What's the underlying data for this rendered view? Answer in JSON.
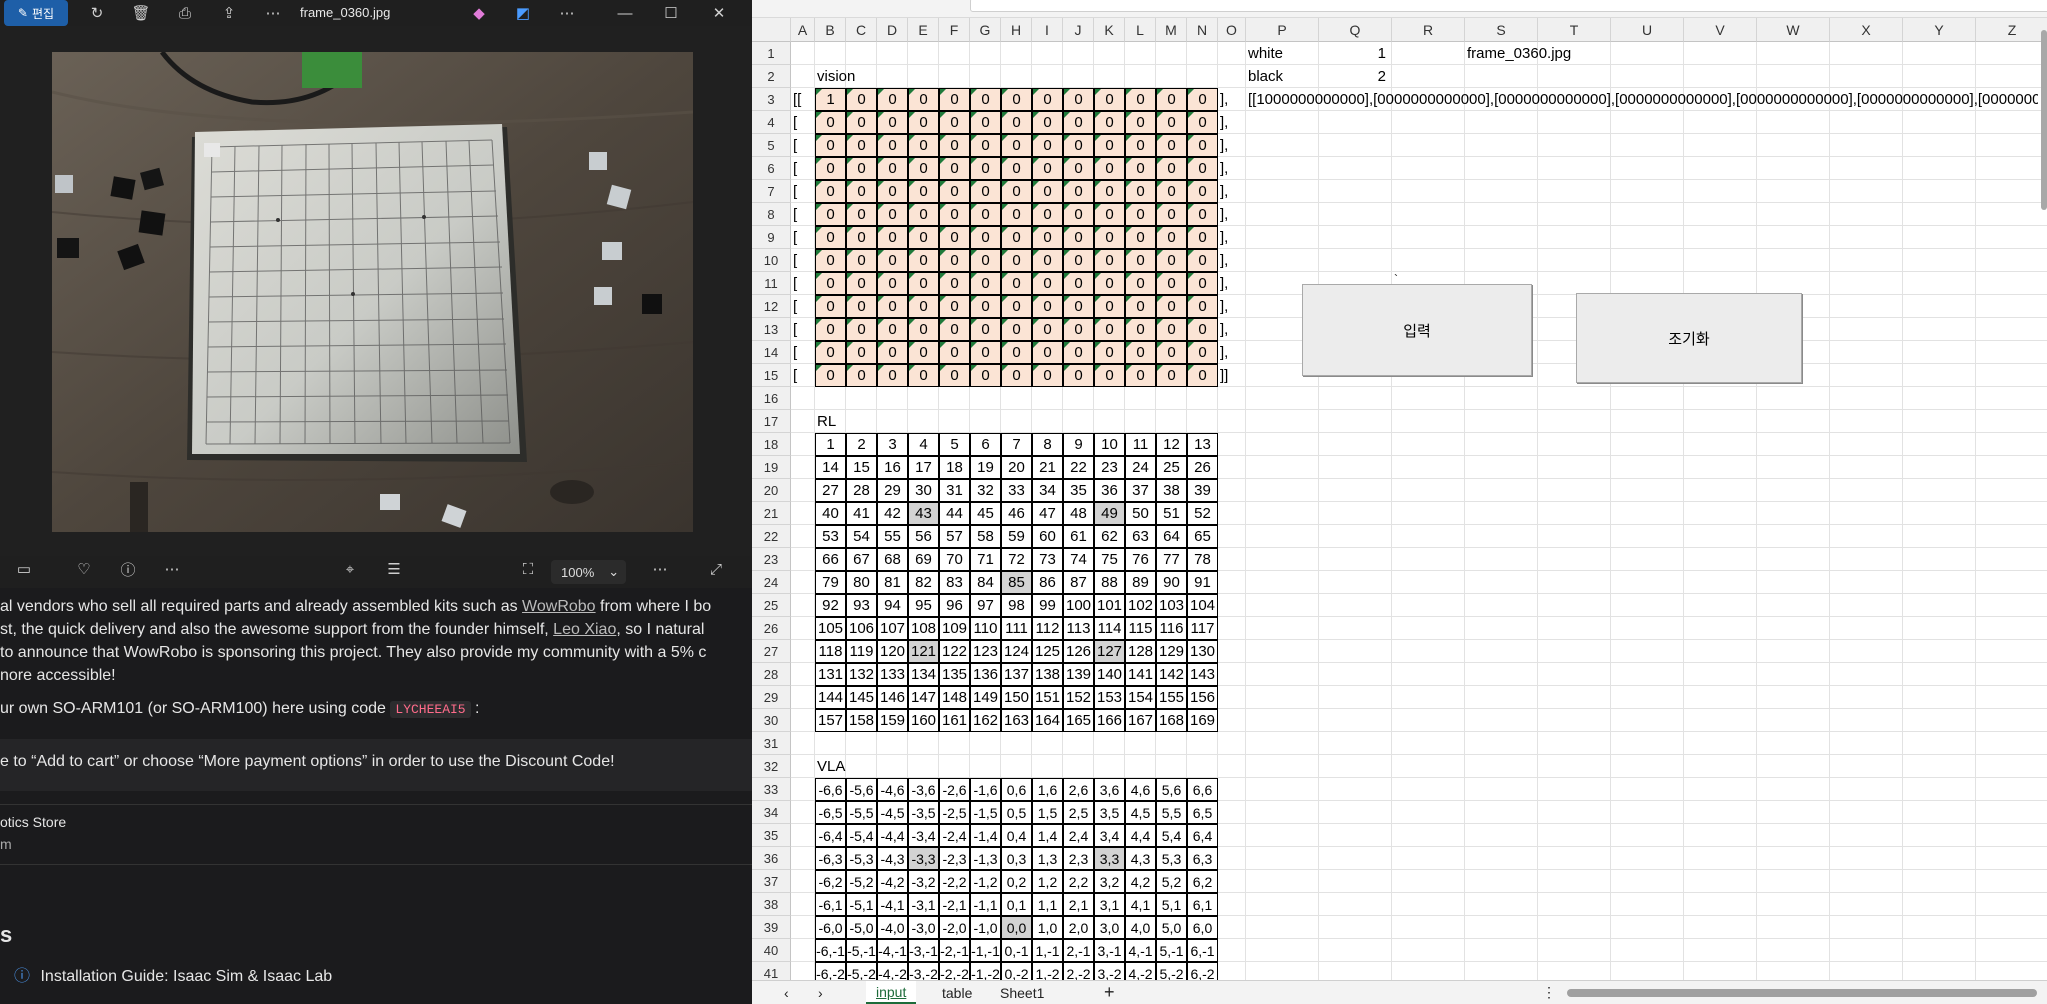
{
  "viewer": {
    "edit_label": "편집",
    "file_title": "frame_0360.jpg",
    "zoom": "100%",
    "photo_alt": "Go board with black and white stones on wooden floor"
  },
  "webpage": {
    "line1a": "al vendors who sell all required parts and already assembled kits such as ",
    "line1_link": "WowRobo",
    "line1b": " from where I bo",
    "line2a": "st, the quick delivery and also the awesome support from the founder himself, ",
    "line2_link": "Leo Xiao",
    "line2b": ", so I natural",
    "line3": " to announce that WowRobo is sponsoring this project. They also provide my community with a 5% c",
    "line4": "nore accessible!",
    "line5a": "ur own SO-ARM101 (or SO-ARM100) here using code ",
    "line5_code": "LYCHEEAI5",
    "line5b": " :",
    "note": "e to “Add to cart” or choose “More payment options” in order to use the Discount Code!",
    "store1": "otics Store",
    "store2": "m",
    "section": "s",
    "guide": "Installation Guide: Isaac Sim & Isaac Lab"
  },
  "sheet": {
    "columns": [
      "A",
      "B",
      "C",
      "D",
      "E",
      "F",
      "G",
      "H",
      "I",
      "J",
      "K",
      "L",
      "M",
      "N",
      "O",
      "P",
      "Q",
      "R",
      "S",
      "T",
      "U",
      "V",
      "W",
      "X",
      "Y",
      "Z"
    ],
    "labels": {
      "vision": "vision",
      "rl": "RL",
      "vla": "VLA",
      "white": "white",
      "white_val": "1",
      "black": "black",
      "black_val": "2",
      "filename": "frame_0360.jpg",
      "matrix_string": "[[1000000000000],[0000000000000],[0000000000000],[0000000000000],[0000000000000],[0000000000000],[0000000000",
      "open_first": "[[",
      "open": "[",
      "close": "],",
      "close_last": "]]",
      "tick": "`"
    },
    "buttons": {
      "input": "입력",
      "reset": "조기화"
    },
    "vision_rows": [
      [
        "1",
        "0",
        "0",
        "0",
        "0",
        "0",
        "0",
        "0",
        "0",
        "0",
        "0",
        "0",
        "0"
      ],
      [
        "0",
        "0",
        "0",
        "0",
        "0",
        "0",
        "0",
        "0",
        "0",
        "0",
        "0",
        "0",
        "0"
      ],
      [
        "0",
        "0",
        "0",
        "0",
        "0",
        "0",
        "0",
        "0",
        "0",
        "0",
        "0",
        "0",
        "0"
      ],
      [
        "0",
        "0",
        "0",
        "0",
        "0",
        "0",
        "0",
        "0",
        "0",
        "0",
        "0",
        "0",
        "0"
      ],
      [
        "0",
        "0",
        "0",
        "0",
        "0",
        "0",
        "0",
        "0",
        "0",
        "0",
        "0",
        "0",
        "0"
      ],
      [
        "0",
        "0",
        "0",
        "0",
        "0",
        "0",
        "0",
        "0",
        "0",
        "0",
        "0",
        "0",
        "0"
      ],
      [
        "0",
        "0",
        "0",
        "0",
        "0",
        "0",
        "0",
        "0",
        "0",
        "0",
        "0",
        "0",
        "0"
      ],
      [
        "0",
        "0",
        "0",
        "0",
        "0",
        "0",
        "0",
        "0",
        "0",
        "0",
        "0",
        "0",
        "0"
      ],
      [
        "0",
        "0",
        "0",
        "0",
        "0",
        "0",
        "0",
        "0",
        "0",
        "0",
        "0",
        "0",
        "0"
      ],
      [
        "0",
        "0",
        "0",
        "0",
        "0",
        "0",
        "0",
        "0",
        "0",
        "0",
        "0",
        "0",
        "0"
      ],
      [
        "0",
        "0",
        "0",
        "0",
        "0",
        "0",
        "0",
        "0",
        "0",
        "0",
        "0",
        "0",
        "0"
      ],
      [
        "0",
        "0",
        "0",
        "0",
        "0",
        "0",
        "0",
        "0",
        "0",
        "0",
        "0",
        "0",
        "0"
      ],
      [
        "0",
        "0",
        "0",
        "0",
        "0",
        "0",
        "0",
        "0",
        "0",
        "0",
        "0",
        "0",
        "0"
      ]
    ],
    "rl_rows": [
      [
        "1",
        "2",
        "3",
        "4",
        "5",
        "6",
        "7",
        "8",
        "9",
        "10",
        "11",
        "12",
        "13"
      ],
      [
        "14",
        "15",
        "16",
        "17",
        "18",
        "19",
        "20",
        "21",
        "22",
        "23",
        "24",
        "25",
        "26"
      ],
      [
        "27",
        "28",
        "29",
        "30",
        "31",
        "32",
        "33",
        "34",
        "35",
        "36",
        "37",
        "38",
        "39"
      ],
      [
        "40",
        "41",
        "42",
        "43",
        "44",
        "45",
        "46",
        "47",
        "48",
        "49",
        "50",
        "51",
        "52"
      ],
      [
        "53",
        "54",
        "55",
        "56",
        "57",
        "58",
        "59",
        "60",
        "61",
        "62",
        "63",
        "64",
        "65"
      ],
      [
        "66",
        "67",
        "68",
        "69",
        "70",
        "71",
        "72",
        "73",
        "74",
        "75",
        "76",
        "77",
        "78"
      ],
      [
        "79",
        "80",
        "81",
        "82",
        "83",
        "84",
        "85",
        "86",
        "87",
        "88",
        "89",
        "90",
        "91"
      ],
      [
        "92",
        "93",
        "94",
        "95",
        "96",
        "97",
        "98",
        "99",
        "100",
        "101",
        "102",
        "103",
        "104"
      ],
      [
        "105",
        "106",
        "107",
        "108",
        "109",
        "110",
        "111",
        "112",
        "113",
        "114",
        "115",
        "116",
        "117"
      ],
      [
        "118",
        "119",
        "120",
        "121",
        "122",
        "123",
        "124",
        "125",
        "126",
        "127",
        "128",
        "129",
        "130"
      ],
      [
        "131",
        "132",
        "133",
        "134",
        "135",
        "136",
        "137",
        "138",
        "139",
        "140",
        "141",
        "142",
        "143"
      ],
      [
        "144",
        "145",
        "146",
        "147",
        "148",
        "149",
        "150",
        "151",
        "152",
        "153",
        "154",
        "155",
        "156"
      ],
      [
        "157",
        "158",
        "159",
        "160",
        "161",
        "162",
        "163",
        "164",
        "165",
        "166",
        "167",
        "168",
        "169"
      ]
    ],
    "rl_highlight": [
      [
        3,
        3
      ],
      [
        3,
        9
      ],
      [
        6,
        6
      ],
      [
        9,
        3
      ],
      [
        9,
        9
      ]
    ],
    "vla_rows": [
      [
        "-6,6",
        "-5,6",
        "-4,6",
        "-3,6",
        "-2,6",
        "-1,6",
        "0,6",
        "1,6",
        "2,6",
        "3,6",
        "4,6",
        "5,6",
        "6,6"
      ],
      [
        "-6,5",
        "-5,5",
        "-4,5",
        "-3,5",
        "-2,5",
        "-1,5",
        "0,5",
        "1,5",
        "2,5",
        "3,5",
        "4,5",
        "5,5",
        "6,5"
      ],
      [
        "-6,4",
        "-5,4",
        "-4,4",
        "-3,4",
        "-2,4",
        "-1,4",
        "0,4",
        "1,4",
        "2,4",
        "3,4",
        "4,4",
        "5,4",
        "6,4"
      ],
      [
        "-6,3",
        "-5,3",
        "-4,3",
        "-3,3",
        "-2,3",
        "-1,3",
        "0,3",
        "1,3",
        "2,3",
        "3,3",
        "4,3",
        "5,3",
        "6,3"
      ],
      [
        "-6,2",
        "-5,2",
        "-4,2",
        "-3,2",
        "-2,2",
        "-1,2",
        "0,2",
        "1,2",
        "2,2",
        "3,2",
        "4,2",
        "5,2",
        "6,2"
      ],
      [
        "-6,1",
        "-5,1",
        "-4,1",
        "-3,1",
        "-2,1",
        "-1,1",
        "0,1",
        "1,1",
        "2,1",
        "3,1",
        "4,1",
        "5,1",
        "6,1"
      ],
      [
        "-6,0",
        "-5,0",
        "-4,0",
        "-3,0",
        "-2,0",
        "-1,0",
        "0,0",
        "1,0",
        "2,0",
        "3,0",
        "4,0",
        "5,0",
        "6,0"
      ],
      [
        "-6,-1",
        "-5,-1",
        "-4,-1",
        "-3,-1",
        "-2,-1",
        "-1,-1",
        "0,-1",
        "1,-1",
        "2,-1",
        "3,-1",
        "4,-1",
        "5,-1",
        "6,-1"
      ],
      [
        "-6,-2",
        "-5,-2",
        "-4,-2",
        "-3,-2",
        "-2,-2",
        "-1,-2",
        "0,-2",
        "1,-2",
        "2,-2",
        "3,-2",
        "4,-2",
        "5,-2",
        "6,-2"
      ]
    ],
    "vla_highlight": [
      [
        3,
        3
      ],
      [
        3,
        9
      ],
      [
        6,
        6
      ]
    ],
    "tabs": [
      "input",
      "table",
      "Sheet1"
    ],
    "add_tab": "+"
  }
}
